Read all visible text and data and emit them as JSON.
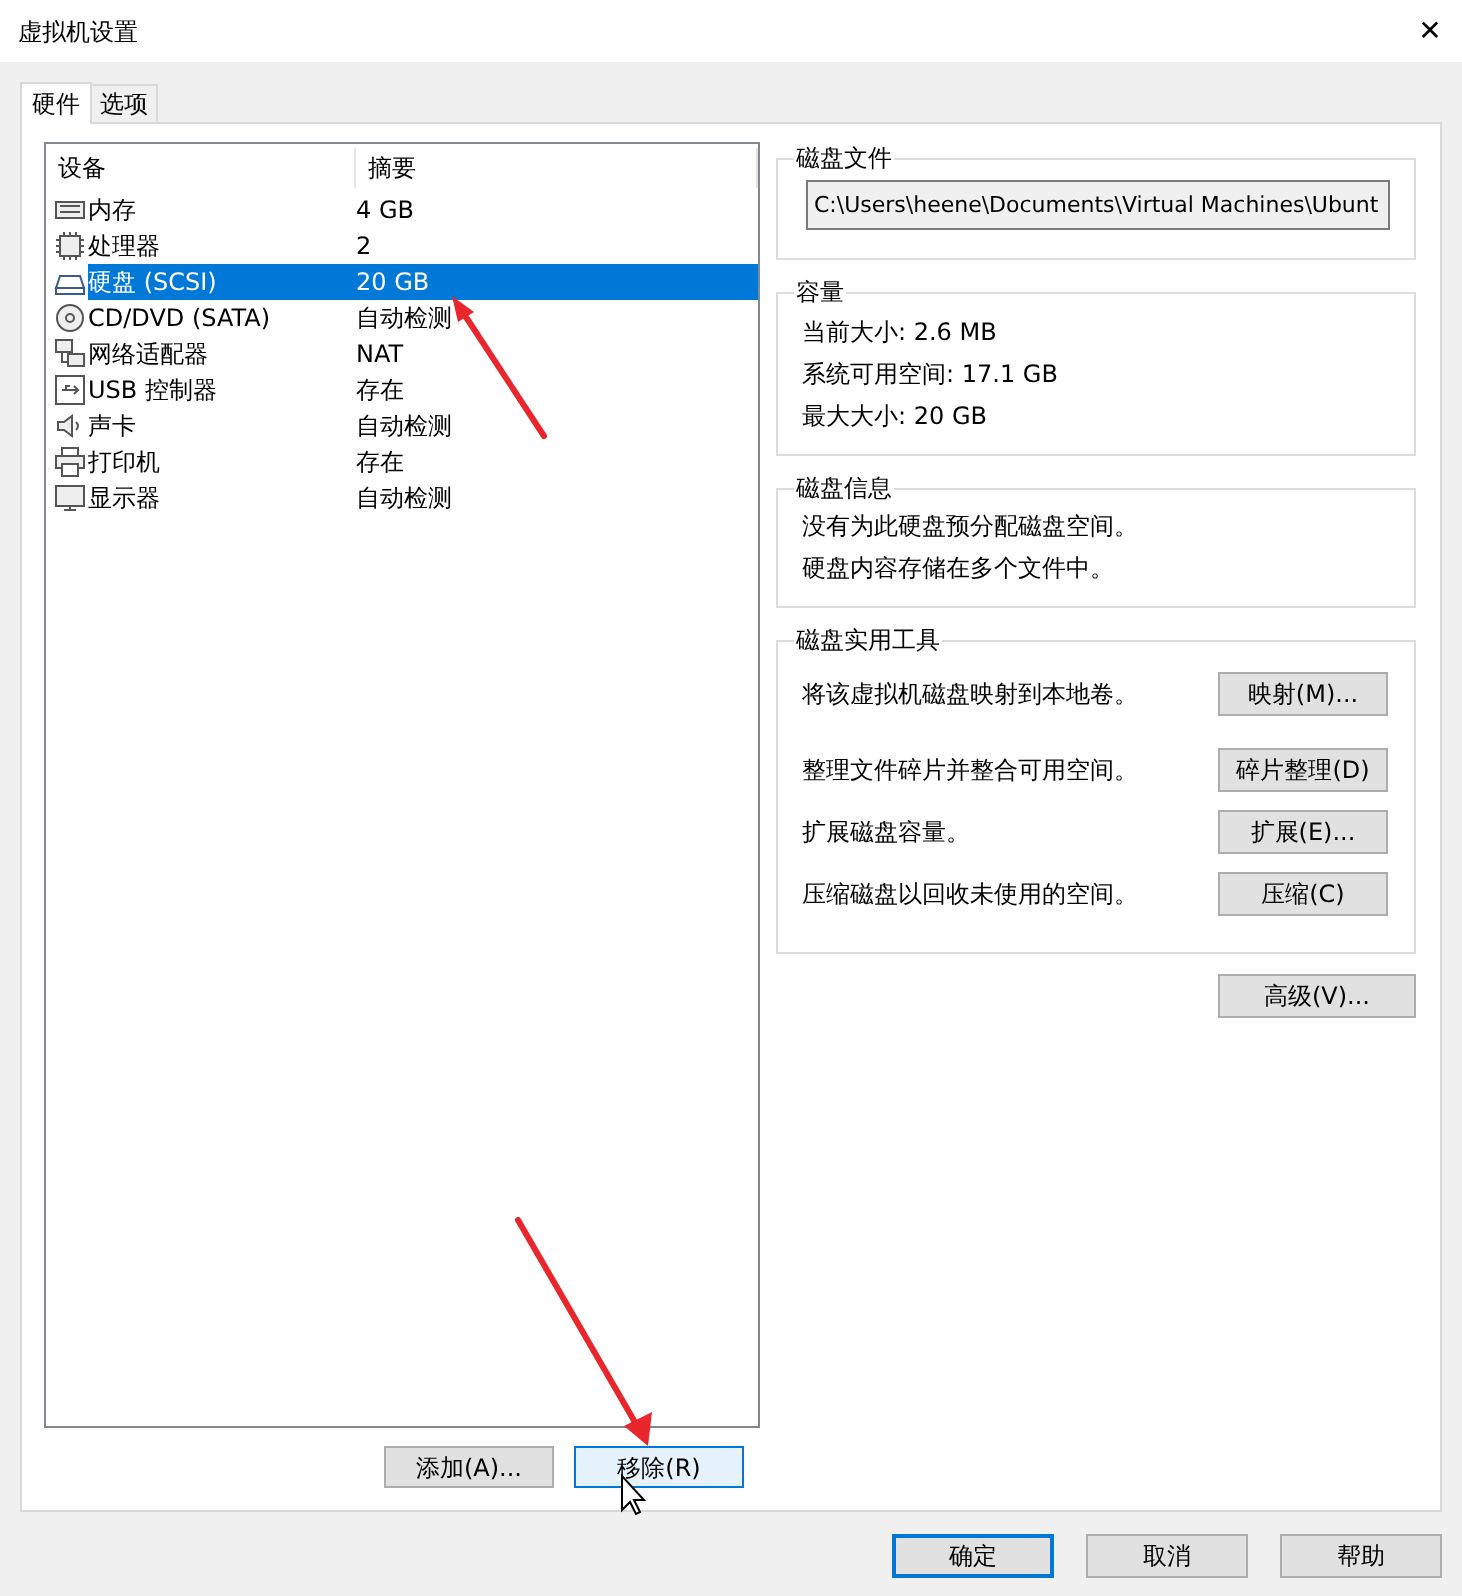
{
  "window": {
    "title": "虚拟机设置",
    "close": "✕"
  },
  "tabs": [
    {
      "label": "硬件",
      "selected": true
    },
    {
      "label": "选项",
      "selected": false
    }
  ],
  "devices": {
    "columns": [
      "设备",
      "摘要"
    ],
    "rows": [
      {
        "kind": "memory",
        "name": "内存",
        "summary": "4 GB",
        "selected": false
      },
      {
        "kind": "cpu",
        "name": "处理器",
        "summary": "2",
        "selected": false
      },
      {
        "kind": "disk",
        "name": "硬盘 (SCSI)",
        "summary": "20 GB",
        "selected": true
      },
      {
        "kind": "cd",
        "name": "CD/DVD (SATA)",
        "summary": "自动检测",
        "selected": false
      },
      {
        "kind": "network",
        "name": "网络适配器",
        "summary": "NAT",
        "selected": false
      },
      {
        "kind": "usb",
        "name": "USB 控制器",
        "summary": "存在",
        "selected": false
      },
      {
        "kind": "sound",
        "name": "声卡",
        "summary": "自动检测",
        "selected": false
      },
      {
        "kind": "printer",
        "name": "打印机",
        "summary": "存在",
        "selected": false
      },
      {
        "kind": "display",
        "name": "显示器",
        "summary": "自动检测",
        "selected": false
      }
    ]
  },
  "device_buttons": [
    {
      "label": "添加(A)...",
      "hovered": false
    },
    {
      "label": "移除(R)",
      "hovered": true
    }
  ],
  "disk_file": {
    "title": "磁盘文件",
    "path": "C:\\Users\\heene\\Documents\\Virtual Machines\\Ubunt"
  },
  "capacity": {
    "title": "容量",
    "lines": [
      "当前大小: 2.6 MB",
      "系统可用空间: 17.1 GB",
      "最大大小: 20 GB"
    ]
  },
  "disk_info": {
    "title": "磁盘信息",
    "lines": [
      "没有为此硬盘预分配磁盘空间。",
      "硬盘内容存储在多个文件中。"
    ]
  },
  "utilities": {
    "title": "磁盘实用工具",
    "rows": [
      {
        "text": "将该虚拟机磁盘映射到本地卷。",
        "button": "映射(M)..."
      },
      {
        "text": "整理文件碎片并整合可用空间。",
        "button": "碎片整理(D)"
      },
      {
        "text": "扩展磁盘容量。",
        "button": "扩展(E)..."
      },
      {
        "text": "压缩磁盘以回收未使用的空间。",
        "button": "压缩(C)"
      }
    ]
  },
  "advanced_button": "高级(V)...",
  "footer_buttons": [
    {
      "label": "确定",
      "default": true
    },
    {
      "label": "取消",
      "default": false
    },
    {
      "label": "帮助",
      "default": false
    }
  ]
}
